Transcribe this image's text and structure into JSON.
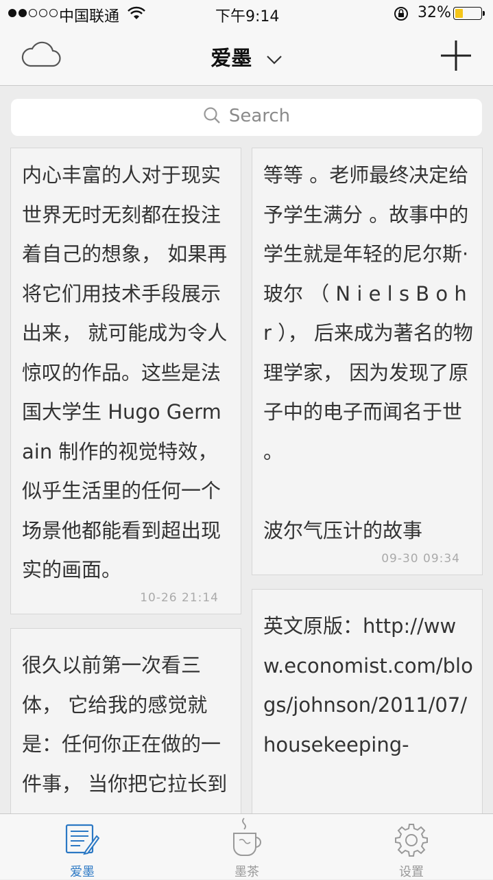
{
  "status_bar": {
    "carrier": "中国联通",
    "time": "下午9:14",
    "battery": "32%",
    "battery_level": 0.32
  },
  "nav": {
    "title": "爱墨",
    "left_icon": "cloud-icon",
    "right_icon": "plus-icon"
  },
  "search": {
    "placeholder": "Search"
  },
  "notes": [
    {
      "text": "内心丰富的人对于现实世界无时无刻都在投注着自己的想象， 如果再将它们用技术手段展示出来， 就可能成为令人惊叹的作品。这些是法国大学生 Hugo Germain 制作的视觉特效， 似乎生活里的任何一个场景他都能看到超出现实的画面。",
      "date": "10-26 21:14"
    },
    {
      "text": "等等 。老师最终决定给予学生满分 。故事中的学生就是年轻的尼尔斯·玻尔 （ N i e l s B o h r ）， 后来成为著名的物理学家， 因为发现了原子中的电子而闻名于世 。\n\n波尔气压计的故事",
      "date": "09-30 09:34"
    },
    {
      "text": "很久以前第一次看三体， 它给我的感觉就是：任何你正在做的一件事， 当你把它拉长到",
      "date": ""
    },
    {
      "text": "英文原版：http://www.economist.com/blogs/johnson/2011/07/housekeeping-",
      "date": ""
    }
  ],
  "tabs": [
    {
      "label": "爱墨",
      "icon": "notes-icon",
      "active": true
    },
    {
      "label": "墨茶",
      "icon": "tea-cup-icon",
      "active": false
    },
    {
      "label": "设置",
      "icon": "gear-icon",
      "active": false
    }
  ]
}
